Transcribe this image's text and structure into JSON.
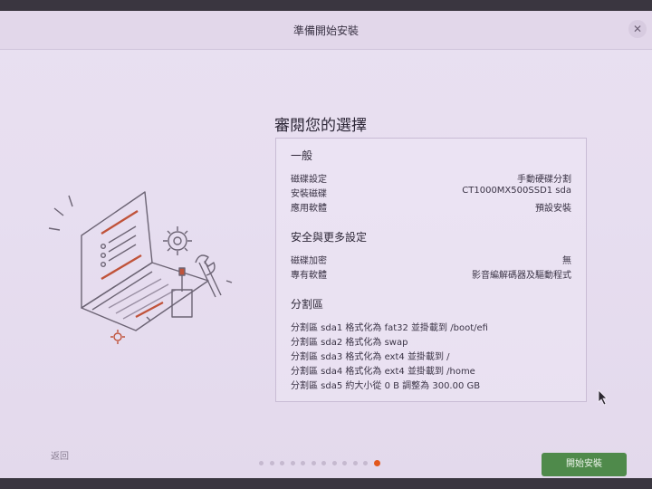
{
  "window": {
    "title": "準備開始安裝",
    "close_icon": "close-icon"
  },
  "review": {
    "heading": "審閱您的選擇",
    "general": {
      "title": "一般",
      "rows": [
        {
          "label": "磁碟設定",
          "value": "手動硬碟分割"
        },
        {
          "label": "安裝磁碟",
          "value": "CT1000MX500SSD1 sda"
        },
        {
          "label": "應用軟體",
          "value": "預設安裝"
        }
      ]
    },
    "security": {
      "title": "安全與更多設定",
      "rows": [
        {
          "label": "磁碟加密",
          "value": "無"
        },
        {
          "label": "專有軟體",
          "value": "影音編解碼器及驅動程式"
        }
      ]
    },
    "partitions": {
      "title": "分割區",
      "items": [
        "分割區 sda1 格式化為 fat32 並掛載到 /boot/efi",
        "分割區 sda2 格式化為 swap",
        "分割區 sda3 格式化為 ext4 並掛載到 /",
        "分割區 sda4 格式化為 ext4 並掛載到 /home",
        "分割區 sda5 約大小從 0 B 調整為 300.00 GB"
      ]
    }
  },
  "footer": {
    "back_label": "返回",
    "install_label": "開始安裝",
    "progress": {
      "total_steps": 12,
      "current_step": 12
    }
  },
  "colors": {
    "accent": "#e2571c",
    "install_button": "#4f8a4b",
    "background": "#e7def0"
  }
}
